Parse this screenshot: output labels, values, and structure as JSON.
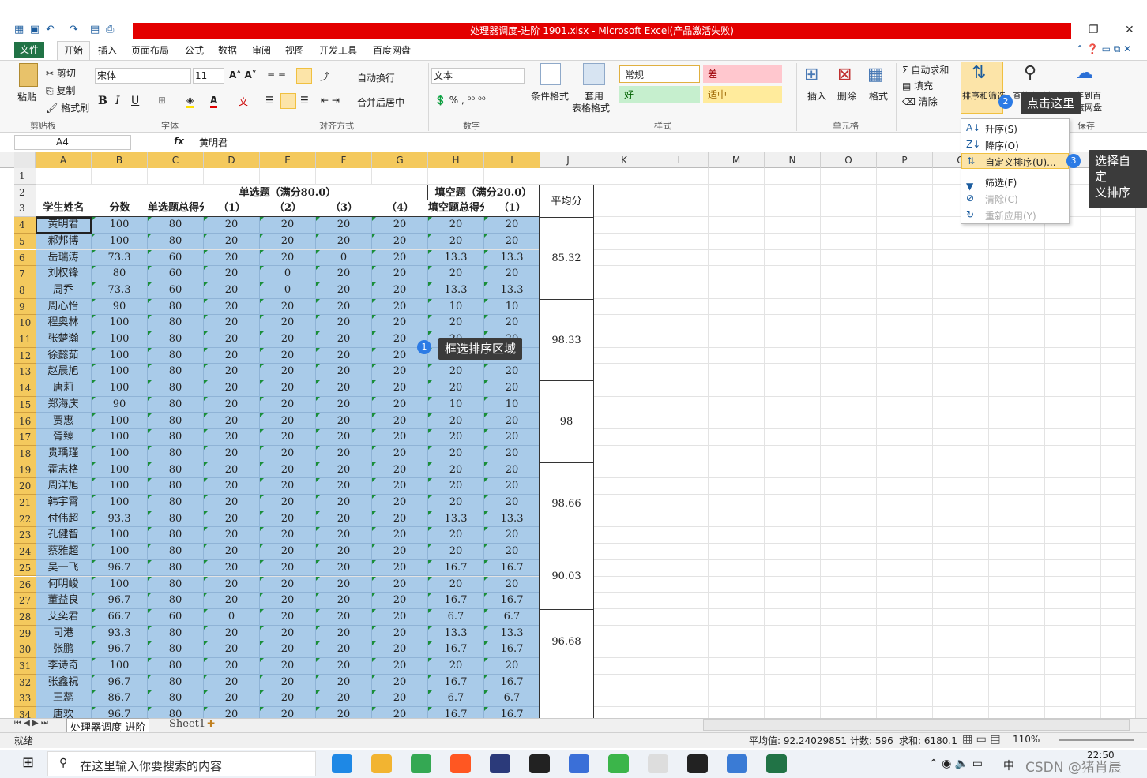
{
  "window": {
    "title": "处理器调度-进阶 1901.xlsx - Microsoft Excel(产品激活失败)"
  },
  "menu": {
    "file": "文件",
    "tabs": [
      "开始",
      "插入",
      "页面布局",
      "公式",
      "数据",
      "审阅",
      "视图",
      "开发工具",
      "百度网盘"
    ]
  },
  "ribbon": {
    "paste": "粘贴",
    "cut": "剪切",
    "copy": "复制",
    "format_painter": "格式刷",
    "clipboard": "剪贴板",
    "font_name": "宋体",
    "font_size": "11",
    "font_group": "字体",
    "wubi": "文",
    "wrap": "自动换行",
    "merge": "合并后居中",
    "align_group": "对齐方式",
    "num_format": "文本",
    "number_group": "数字",
    "cond_format": "条件格式",
    "table_format_1": "套用",
    "table_format_2": "表格格式",
    "style_normal": "常规",
    "style_bad": "差",
    "style_good": "好",
    "style_neutral": "适中",
    "styles_group": "样式",
    "insert": "插入",
    "delete": "删除",
    "format": "格式",
    "cells_group": "单元格",
    "autosum": "Σ 自动求和",
    "fill": "填充",
    "clear": "清除",
    "sort_filter": "排序和筛选",
    "find_select": "查找和选择",
    "save_baidu_1": "保存到百",
    "save_baidu_2": "度网盘",
    "save_group": "保存"
  },
  "formula": {
    "cell_ref": "A4",
    "fx": "fx",
    "value": "黄明君"
  },
  "columns": [
    "A",
    "B",
    "C",
    "D",
    "E",
    "F",
    "G",
    "H",
    "I",
    "J",
    "K",
    "L",
    "M",
    "N",
    "O",
    "P",
    "Q"
  ],
  "header": {
    "r2_single": "单选题（满分80.0）",
    "r2_blank": "填空题（满分20.0）",
    "avg": "平均分",
    "r3": [
      "学生姓名",
      "分数",
      "单选题总得分",
      "（1）",
      "（2）",
      "（3）",
      "（4）",
      "填空题总得分",
      "（1）"
    ]
  },
  "rows": [
    [
      "黄明君",
      "100",
      "80",
      "20",
      "20",
      "20",
      "20",
      "20",
      "20"
    ],
    [
      "郝邦博",
      "100",
      "80",
      "20",
      "20",
      "20",
      "20",
      "20",
      "20"
    ],
    [
      "岳瑞涛",
      "73.3",
      "60",
      "20",
      "20",
      "0",
      "20",
      "13.3",
      "13.3"
    ],
    [
      "刘权锋",
      "80",
      "60",
      "20",
      "0",
      "20",
      "20",
      "20",
      "20"
    ],
    [
      "周乔",
      "73.3",
      "60",
      "20",
      "0",
      "20",
      "20",
      "13.3",
      "13.3"
    ],
    [
      "周心怡",
      "90",
      "80",
      "20",
      "20",
      "20",
      "20",
      "10",
      "10"
    ],
    [
      "程奥林",
      "100",
      "80",
      "20",
      "20",
      "20",
      "20",
      "20",
      "20"
    ],
    [
      "张楚瀚",
      "100",
      "80",
      "20",
      "20",
      "20",
      "20",
      "20",
      "20"
    ],
    [
      "徐懿茹",
      "100",
      "80",
      "20",
      "20",
      "20",
      "20",
      "20",
      "20"
    ],
    [
      "赵晨旭",
      "100",
      "80",
      "20",
      "20",
      "20",
      "20",
      "20",
      "20"
    ],
    [
      "唐莉",
      "100",
      "80",
      "20",
      "20",
      "20",
      "20",
      "20",
      "20"
    ],
    [
      "郑海庆",
      "90",
      "80",
      "20",
      "20",
      "20",
      "20",
      "10",
      "10"
    ],
    [
      "贾惠",
      "100",
      "80",
      "20",
      "20",
      "20",
      "20",
      "20",
      "20"
    ],
    [
      "胥臻",
      "100",
      "80",
      "20",
      "20",
      "20",
      "20",
      "20",
      "20"
    ],
    [
      "贵瑀瑾",
      "100",
      "80",
      "20",
      "20",
      "20",
      "20",
      "20",
      "20"
    ],
    [
      "霍志格",
      "100",
      "80",
      "20",
      "20",
      "20",
      "20",
      "20",
      "20"
    ],
    [
      "周洋旭",
      "100",
      "80",
      "20",
      "20",
      "20",
      "20",
      "20",
      "20"
    ],
    [
      "韩宇霄",
      "100",
      "80",
      "20",
      "20",
      "20",
      "20",
      "20",
      "20"
    ],
    [
      "付伟超",
      "93.3",
      "80",
      "20",
      "20",
      "20",
      "20",
      "13.3",
      "13.3"
    ],
    [
      "孔健智",
      "100",
      "80",
      "20",
      "20",
      "20",
      "20",
      "20",
      "20"
    ],
    [
      "蔡雅超",
      "100",
      "80",
      "20",
      "20",
      "20",
      "20",
      "20",
      "20"
    ],
    [
      "吴一飞",
      "96.7",
      "80",
      "20",
      "20",
      "20",
      "20",
      "16.7",
      "16.7"
    ],
    [
      "何明峻",
      "100",
      "80",
      "20",
      "20",
      "20",
      "20",
      "20",
      "20"
    ],
    [
      "董益良",
      "96.7",
      "80",
      "20",
      "20",
      "20",
      "20",
      "16.7",
      "16.7"
    ],
    [
      "艾奕君",
      "66.7",
      "60",
      "0",
      "20",
      "20",
      "20",
      "6.7",
      "6.7"
    ],
    [
      "司港",
      "93.3",
      "80",
      "20",
      "20",
      "20",
      "20",
      "13.3",
      "13.3"
    ],
    [
      "张鹏",
      "96.7",
      "80",
      "20",
      "20",
      "20",
      "20",
      "16.7",
      "16.7"
    ],
    [
      "李诗奇",
      "100",
      "80",
      "20",
      "20",
      "20",
      "20",
      "20",
      "20"
    ],
    [
      "张鑫祝",
      "96.7",
      "80",
      "20",
      "20",
      "20",
      "20",
      "16.7",
      "16.7"
    ],
    [
      "王蕊",
      "86.7",
      "80",
      "20",
      "20",
      "20",
      "20",
      "6.7",
      "6.7"
    ],
    [
      "唐欢",
      "96.7",
      "80",
      "20",
      "20",
      "20",
      "20",
      "16.7",
      "16.7"
    ]
  ],
  "averages": [
    "85.32",
    "98.33",
    "98",
    "98.66",
    "90.03",
    "96.68"
  ],
  "dropdown": {
    "asc": "升序(S)",
    "desc": "降序(O)",
    "custom": "自定义排序(U)...",
    "filter": "筛选(F)",
    "clear": "清除(C)",
    "reapply": "重新应用(Y)"
  },
  "tips": {
    "t1": "框选排序区域",
    "t2": "点击这里",
    "t3a": "选择自定",
    "t3b": "义排序",
    "n1": "1",
    "n2": "2",
    "n3": "3"
  },
  "sheets": {
    "active": "处理器调度-进阶",
    "other": "Sheet1"
  },
  "status": {
    "ready": "就绪",
    "avg": "平均值: 92.24029851",
    "count": "计数: 596",
    "sum": "求和: 6180.1",
    "zoom": "110%"
  },
  "taskbar": {
    "search": "在这里输入你要搜索的内容",
    "time": "22:50",
    "ime": "中",
    "watermark": "CSDN @猪肖晨"
  }
}
